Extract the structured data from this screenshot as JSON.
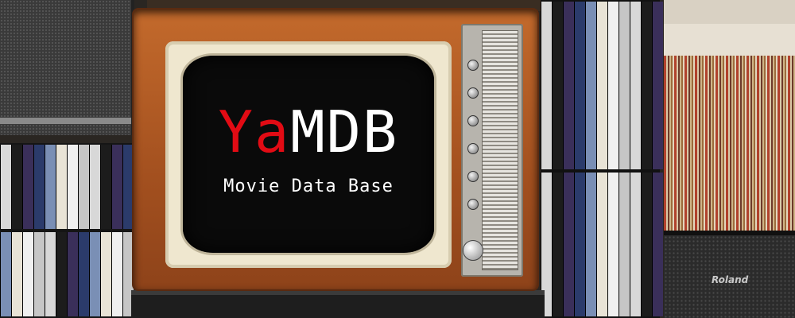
{
  "logo": {
    "ya": "Ya",
    "mdb": "MDB",
    "subtitle": "Movie Data Base"
  },
  "brand_label": "Roland",
  "colors": {
    "ya_red": "#e20b14",
    "text_white": "#ffffff",
    "tv_wood": "#a3501f",
    "screen_black": "#0a0a0a"
  }
}
